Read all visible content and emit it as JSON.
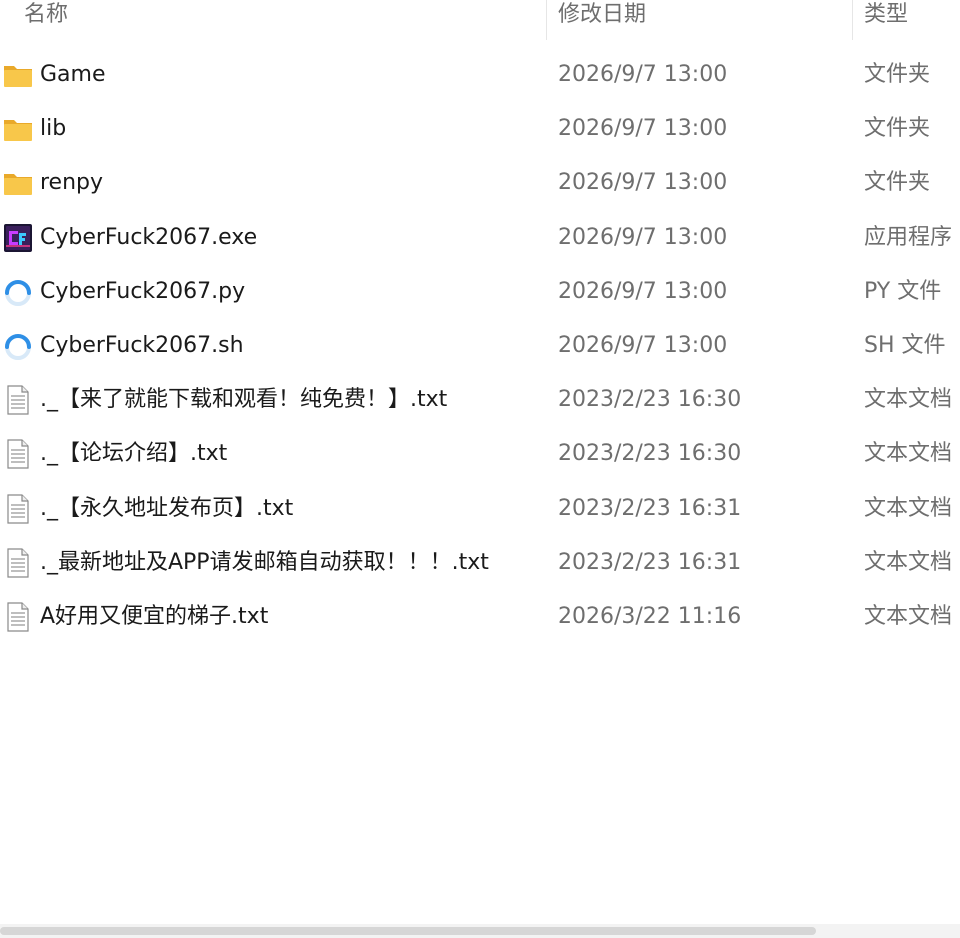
{
  "columns": {
    "name": "名称",
    "date": "修改日期",
    "type": "类型"
  },
  "files": [
    {
      "name": "Game",
      "date": "2026/9/7 13:00",
      "type": "文件夹",
      "icon": "folder-icon"
    },
    {
      "name": "lib",
      "date": "2026/9/7 13:00",
      "type": "文件夹",
      "icon": "folder-icon"
    },
    {
      "name": "renpy",
      "date": "2026/9/7 13:00",
      "type": "文件夹",
      "icon": "folder-icon"
    },
    {
      "name": "CyberFuck2067.exe",
      "date": "2026/9/7 13:00",
      "type": "应用程序",
      "icon": "app-icon"
    },
    {
      "name": "CyberFuck2067.py",
      "date": "2026/9/7 13:00",
      "type": "PY 文件",
      "icon": "loading-ring-icon"
    },
    {
      "name": "CyberFuck2067.sh",
      "date": "2026/9/7 13:00",
      "type": "SH 文件",
      "icon": "loading-ring-icon"
    },
    {
      "name": "._【来了就能下载和观看！纯免费！】.txt",
      "date": "2023/2/23 16:30",
      "type": "文本文档",
      "icon": "text-document-icon"
    },
    {
      "name": "._【论坛介绍】.txt",
      "date": "2023/2/23 16:30",
      "type": "文本文档",
      "icon": "text-document-icon"
    },
    {
      "name": "._【永久地址发布页】.txt",
      "date": "2023/2/23 16:31",
      "type": "文本文档",
      "icon": "text-document-icon"
    },
    {
      "name": "._最新地址及APP请发邮箱自动获取！！！.txt",
      "date": "2023/2/23 16:31",
      "type": "文本文档",
      "icon": "text-document-icon"
    },
    {
      "name": "A好用又便宜的梯子.txt",
      "date": "2026/3/22 11:16",
      "type": "文本文档",
      "icon": "text-document-icon"
    }
  ],
  "colors": {
    "folder": "#F8C74A",
    "folder_dark": "#E9A92A",
    "ring": "#2E8FE6",
    "header_text": "#6E6E6E"
  },
  "scrollbar": {
    "position": 0.85
  }
}
